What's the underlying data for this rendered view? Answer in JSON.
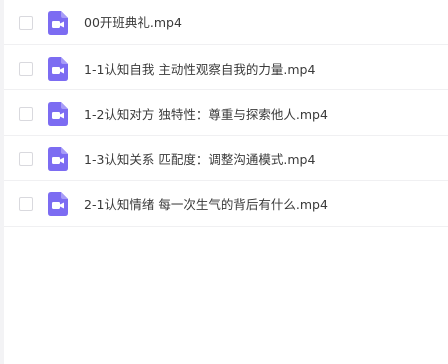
{
  "file_list": {
    "items": [
      {
        "name": "00开班典礼.mp4",
        "icon": "video-file-icon"
      },
      {
        "name": "1-1认知自我 主动性观察自我的力量.mp4",
        "icon": "video-file-icon"
      },
      {
        "name": "1-2认知对方 独特性：尊重与探索他人.mp4",
        "icon": "video-file-icon"
      },
      {
        "name": "1-3认知关系 匹配度：调整沟通模式.mp4",
        "icon": "video-file-icon"
      },
      {
        "name": "2-1认知情绪 每一次生气的背后有什么.mp4",
        "icon": "video-file-icon"
      }
    ]
  },
  "colors": {
    "icon_purple": "#7c6cf2",
    "text": "#3a3a3a",
    "divider": "#f0f0f2",
    "checkbox_border": "#d9d9de"
  }
}
